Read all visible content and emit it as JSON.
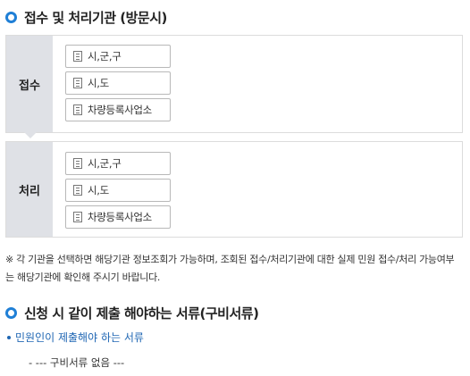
{
  "section1": {
    "title": "접수 및 처리기관 (방문시)"
  },
  "reception": {
    "label": "접수",
    "buttons": [
      "시,군,구",
      "시,도",
      "차량등록사업소"
    ]
  },
  "processing": {
    "label": "처리",
    "buttons": [
      "시,군,구",
      "시,도",
      "차량등록사업소"
    ]
  },
  "notice": "※ 각 기관을 선택하면 해당기관 정보조회가 가능하며, 조회된 접수/처리기관에 대한 실제 민원 접수/처리 가능여부는 해당기관에 확인해 주시기 바랍니다.",
  "section2": {
    "title": "신청 시 같이 제출 해야하는 서류(구비서류)"
  },
  "documents": {
    "heading": "민원인이 제출해야 하는 서류",
    "none": "- --- 구비서류 없음 ---"
  },
  "colors": {
    "accent": "#1f7fd6",
    "label_bg": "#dfe1e6",
    "link": "#1f66b3"
  }
}
